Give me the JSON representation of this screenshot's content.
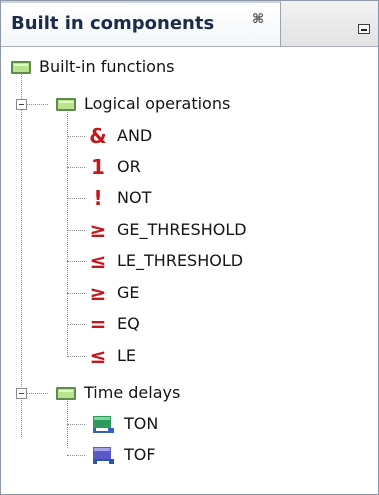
{
  "panel": {
    "tab_title": "Built in components",
    "tab_close_glyph": "⌘",
    "minimize_icon": "minimize-icon"
  },
  "tree": {
    "root": {
      "label": "Built-in functions",
      "icon": "folder-icon",
      "color": "#b8e38f"
    },
    "logical_operations": {
      "label": "Logical operations",
      "items": [
        {
          "symbol": "&",
          "label": "AND",
          "icon": "and-icon"
        },
        {
          "symbol": "1",
          "label": "OR",
          "icon": "or-icon"
        },
        {
          "symbol": "!",
          "label": "NOT",
          "icon": "not-icon"
        },
        {
          "symbol": "≥",
          "label": "GE_THRESHOLD",
          "icon": "ge-threshold-icon"
        },
        {
          "symbol": "≤",
          "label": "LE_THRESHOLD",
          "icon": "le-threshold-icon"
        },
        {
          "symbol": "≥",
          "label": "GE",
          "icon": "ge-icon"
        },
        {
          "symbol": "=",
          "label": "EQ",
          "icon": "eq-icon"
        },
        {
          "symbol": "≤",
          "label": "LE",
          "icon": "le-icon"
        }
      ]
    },
    "time_delays": {
      "label": "Time delays",
      "items": [
        {
          "label": "TON",
          "icon": "ton-timer-icon",
          "color": "#2d9b5b"
        },
        {
          "label": "TOF",
          "icon": "tof-timer-icon",
          "color": "#5b58c8"
        }
      ]
    }
  },
  "colors": {
    "operator_symbol": "#c4161c",
    "tab_text": "#1c2b47",
    "folder_green": "#b8e38f"
  }
}
